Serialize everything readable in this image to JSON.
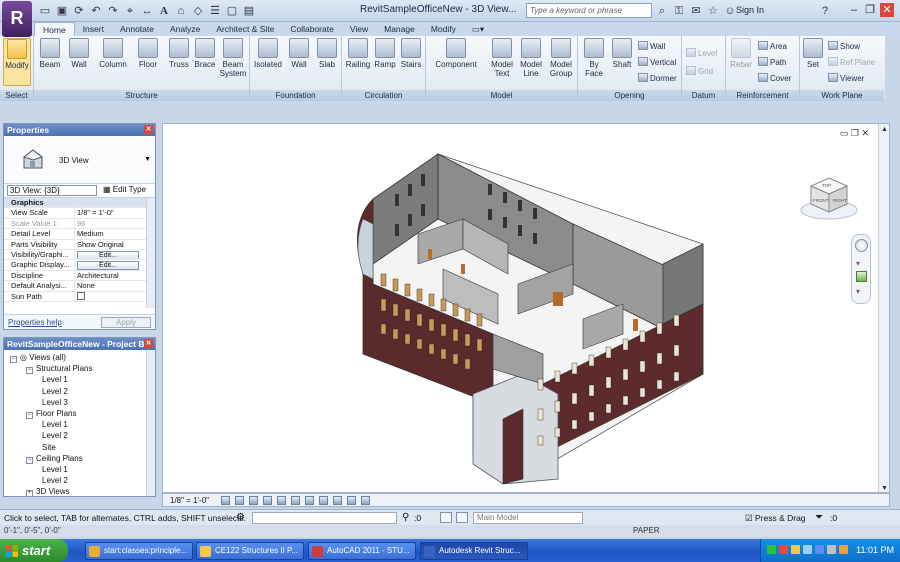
{
  "title": "RevitSampleOfficeNew - 3D View...",
  "search": {
    "placeholder": "Type a keyword or phrase"
  },
  "signin": "Sign In",
  "tabs": [
    "Home",
    "Insert",
    "Annotate",
    "Analyze",
    "Architect & Site",
    "Collaborate",
    "View",
    "Manage",
    "Modify"
  ],
  "ribbon": {
    "select_panel": {
      "label": "Select",
      "modify": "Modify"
    },
    "structure_panel": {
      "label": "Structure",
      "buttons": [
        "Beam",
        "Wall",
        "Column",
        "Floor",
        "Truss",
        "Brace",
        "Beam System"
      ]
    },
    "foundation_panel": {
      "label": "Foundation",
      "buttons": [
        "Isolated",
        "Wall",
        "Slab"
      ]
    },
    "circulation_panel": {
      "label": "Circulation",
      "buttons": [
        "Railing",
        "Ramp",
        "Stairs"
      ]
    },
    "model_panel": {
      "label": "Model",
      "buttons": [
        "Component",
        "Model Text",
        "Model Line",
        "Model Group"
      ]
    },
    "opening_panel": {
      "label": "Opening",
      "buttons": [
        "By Face",
        "Shaft"
      ],
      "small": [
        "Wall",
        "Vertical",
        "Dormer"
      ]
    },
    "datum_panel": {
      "label": "Datum",
      "small": [
        "Level",
        "Grid"
      ]
    },
    "reinforcement_panel": {
      "label": "Reinforcement",
      "rebar": "Rebar",
      "small": [
        "Area",
        "Path",
        "Cover"
      ]
    },
    "workplane_panel": {
      "label": "Work Plane",
      "set": "Set",
      "small": [
        "Show",
        "Ref Plane",
        "Viewer"
      ]
    }
  },
  "properties": {
    "title": "Properties",
    "type_name": "3D View",
    "view_selector": "3D View: {3D}",
    "edit_type": "Edit Type",
    "rows": [
      {
        "k": "Graphics",
        "v": "",
        "group": true
      },
      {
        "k": "View Scale",
        "v": "1/8\" = 1'-0\""
      },
      {
        "k": "Scale Value 1:",
        "v": "96",
        "dim": true
      },
      {
        "k": "Detail Level",
        "v": "Medium"
      },
      {
        "k": "Parts Visibility",
        "v": "Show Original"
      },
      {
        "k": "Visibility/Graphi...",
        "v": "Edit...",
        "button": true
      },
      {
        "k": "Graphic Display...",
        "v": "Edit...",
        "button": true
      },
      {
        "k": "Discipline",
        "v": "Architectural"
      },
      {
        "k": "Default Analysi...",
        "v": "None"
      },
      {
        "k": "Sun Path",
        "v": "",
        "checkbox": true
      }
    ],
    "help": "Properties help",
    "apply": "Apply"
  },
  "browser": {
    "title": "RevitSampleOfficeNew - Project B...",
    "items": [
      {
        "label": "Views (all)",
        "depth": 0,
        "toggle": "-"
      },
      {
        "label": "Structural Plans",
        "depth": 1,
        "toggle": "-"
      },
      {
        "label": "Level 1",
        "depth": 2
      },
      {
        "label": "Level 2",
        "depth": 2
      },
      {
        "label": "Level 3",
        "depth": 2
      },
      {
        "label": "Floor Plans",
        "depth": 1,
        "toggle": "-"
      },
      {
        "label": "Level 1",
        "depth": 2
      },
      {
        "label": "Level 2",
        "depth": 2
      },
      {
        "label": "Site",
        "depth": 2
      },
      {
        "label": "Ceiling Plans",
        "depth": 1,
        "toggle": "-"
      },
      {
        "label": "Level 1",
        "depth": 2
      },
      {
        "label": "Level 2",
        "depth": 2
      },
      {
        "label": "3D Views",
        "depth": 1,
        "toggle": "+"
      }
    ]
  },
  "viewcube": {
    "top": "TOP",
    "front": "FRONT",
    "right": "RIGHT"
  },
  "view_bar": {
    "scale": "1/8\" = 1'-0\""
  },
  "status": {
    "message": "Click to select, TAB for alternates, CTRL adds, SHIFT unselects.",
    "count": ":0",
    "model_dd": "Main Model",
    "press_drag": "Press & Drag",
    "filter_count": ":0",
    "coords": "0'-1\", 0'-5\", 0'-0\"",
    "paper": "PAPER"
  },
  "taskbar": {
    "start": "start",
    "tasks": [
      {
        "label": "start:classes:principle...",
        "color": "#e8b030"
      },
      {
        "label": "CE122 Structures II P...",
        "color": "#f2c94c"
      },
      {
        "label": "AutoCAD 2011 - STU...",
        "color": "#d23c3c"
      },
      {
        "label": "Autodesk Revit Struc...",
        "color": "#3a62c4"
      }
    ],
    "clock": "11:01 PM"
  },
  "colors": {
    "ribbon_accent": "#fbe3a0",
    "pane_title": "#4b71b3",
    "taskbar": "#1f55c4",
    "start": "#2b8a2b"
  }
}
